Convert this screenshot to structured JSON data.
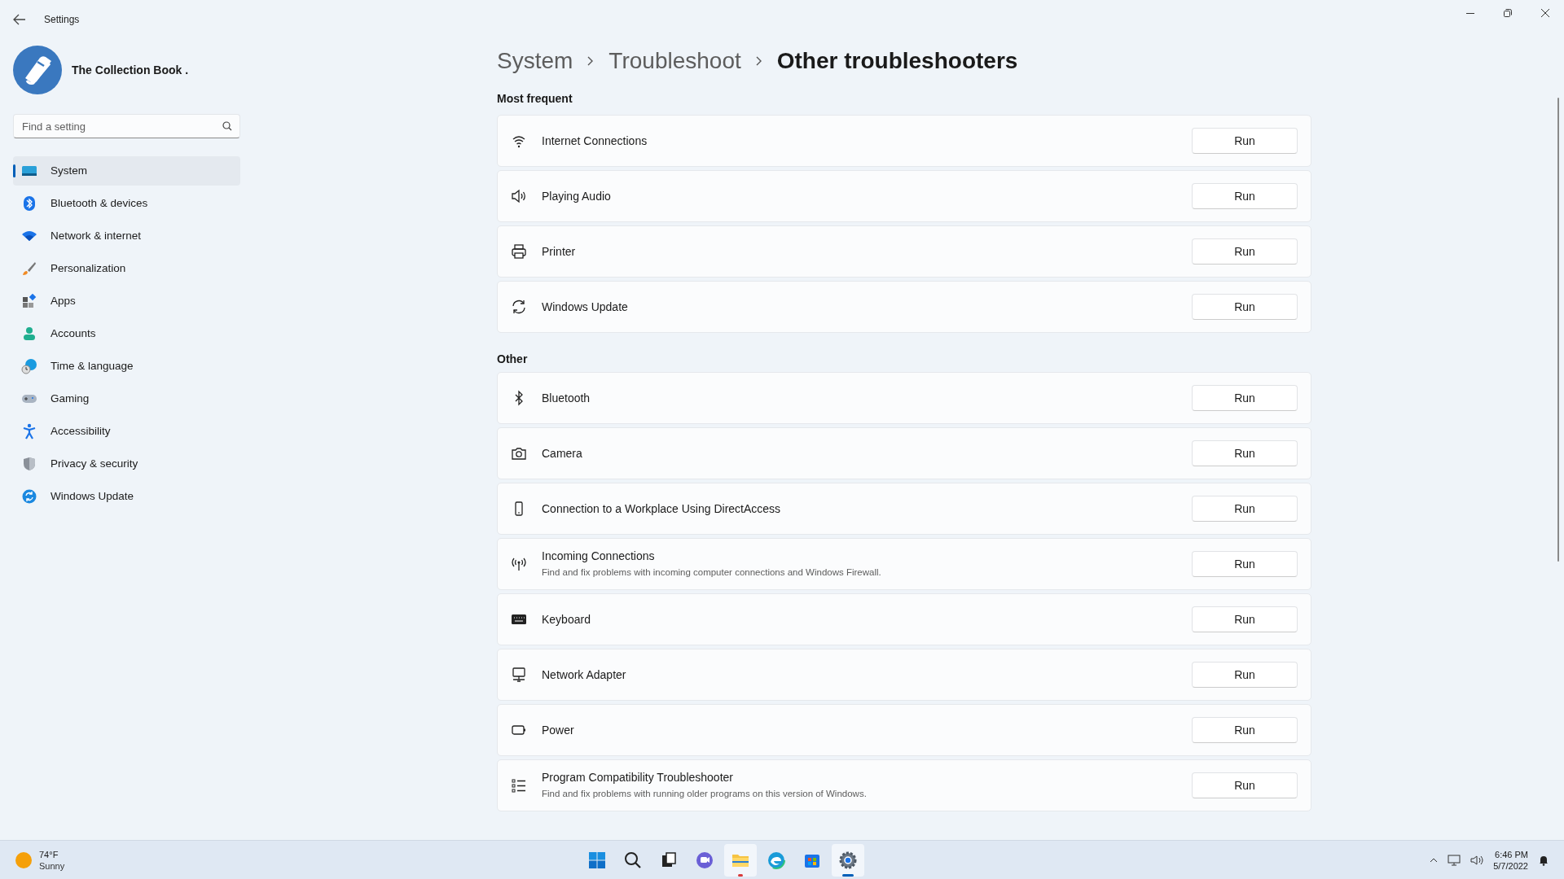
{
  "window": {
    "title": "Settings"
  },
  "profile": {
    "name": "The Collection Book ."
  },
  "search": {
    "placeholder": "Find a setting"
  },
  "sidebar": {
    "items": [
      {
        "label": "System",
        "selected": true
      },
      {
        "label": "Bluetooth & devices",
        "selected": false
      },
      {
        "label": "Network & internet",
        "selected": false
      },
      {
        "label": "Personalization",
        "selected": false
      },
      {
        "label": "Apps",
        "selected": false
      },
      {
        "label": "Accounts",
        "selected": false
      },
      {
        "label": "Time & language",
        "selected": false
      },
      {
        "label": "Gaming",
        "selected": false
      },
      {
        "label": "Accessibility",
        "selected": false
      },
      {
        "label": "Privacy & security",
        "selected": false
      },
      {
        "label": "Windows Update",
        "selected": false
      }
    ]
  },
  "breadcrumb": [
    "System",
    "Troubleshoot",
    "Other troubleshooters"
  ],
  "sections": [
    {
      "title": "Most frequent",
      "items": [
        {
          "label": "Internet Connections",
          "button": "Run"
        },
        {
          "label": "Playing Audio",
          "button": "Run"
        },
        {
          "label": "Printer",
          "button": "Run"
        },
        {
          "label": "Windows Update",
          "button": "Run"
        }
      ]
    },
    {
      "title": "Other",
      "items": [
        {
          "label": "Bluetooth",
          "button": "Run"
        },
        {
          "label": "Camera",
          "button": "Run"
        },
        {
          "label": "Connection to a Workplace Using DirectAccess",
          "button": "Run"
        },
        {
          "label": "Incoming Connections",
          "description": "Find and fix problems with incoming computer connections and Windows Firewall.",
          "button": "Run"
        },
        {
          "label": "Keyboard",
          "button": "Run"
        },
        {
          "label": "Network Adapter",
          "button": "Run"
        },
        {
          "label": "Power",
          "button": "Run"
        },
        {
          "label": "Program Compatibility Troubleshooter",
          "description": "Find and fix problems with running older programs on this version of Windows.",
          "button": "Run"
        }
      ]
    }
  ],
  "taskbar": {
    "weather": {
      "temperature": "74°F",
      "condition": "Sunny"
    },
    "apps": [
      {
        "selected": false,
        "attention": false
      },
      {
        "selected": false,
        "attention": false
      },
      {
        "selected": false,
        "attention": false
      },
      {
        "selected": false,
        "attention": false
      },
      {
        "selected": false,
        "attention": true
      },
      {
        "selected": false,
        "attention": false
      },
      {
        "selected": false,
        "attention": false
      },
      {
        "selected": true,
        "attention": false
      }
    ],
    "clock": {
      "time": "6:46 PM",
      "date": "5/7/2022"
    }
  }
}
